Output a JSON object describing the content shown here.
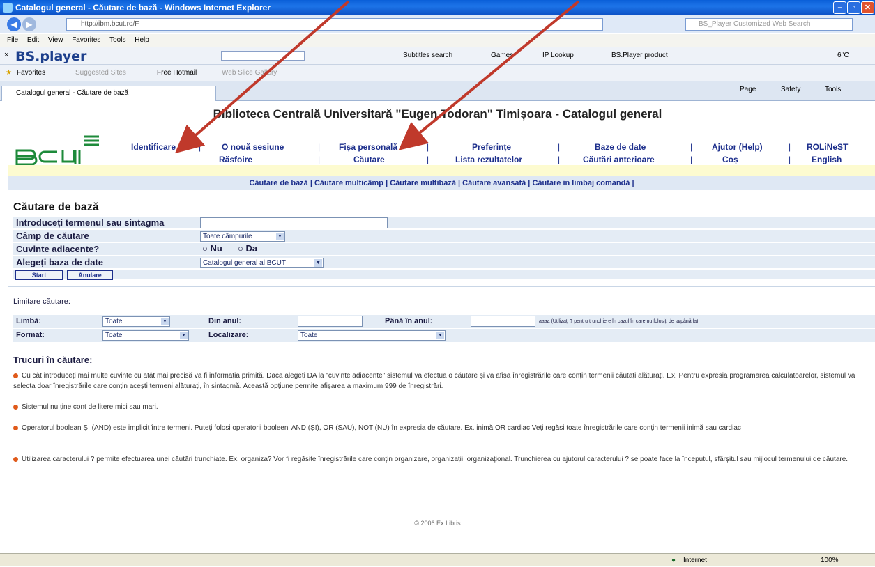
{
  "window": {
    "title": "Catalogul general - Căutare de bază - Windows Internet Explorer",
    "url": "http://ibm.bcut.ro/F",
    "search_placeholder": "BS_Player Customized Web Search",
    "tab_title": "Catalogul general - Căutare de bază"
  },
  "menu": [
    "File",
    "Edit",
    "View",
    "Favorites",
    "Tools",
    "Help"
  ],
  "bsbar": {
    "logo": "BS.player",
    "items": [
      "Subtitles search",
      "Games",
      "IP Lookup",
      "BS.Player product"
    ],
    "temp": "6°C"
  },
  "favbar": [
    "Favorites",
    "Suggested Sites",
    "Free Hotmail",
    "Web Slice Gallery"
  ],
  "ie_tools": [
    "Page",
    "Safety",
    "Tools"
  ],
  "page": {
    "heading": "Biblioteca Centrală Universitară \"Eugen Todoran\" Timișoara - Catalogul general",
    "nav_row1": [
      "Identificare",
      "O nouă sesiune",
      "Fișa personală",
      "Preferințe",
      "Baze de date",
      "Ajutor (Help)",
      "ROLiNeST"
    ],
    "nav_row2": [
      "Răsfoire",
      "Căutare",
      "Lista rezultatelor",
      "Căutări anterioare",
      "Coș",
      "English"
    ],
    "subnav": "Căutare de bază | Căutare multicâmp | Căutare multibază | Căutare avansată | Căutare în limbaj comandă |",
    "section_title": "Căutare de bază",
    "form": {
      "term_label": "Introduceți termenul sau sintagma",
      "field_label": "Câmp de căutare",
      "field_value": "Toate câmpurile",
      "adjacent_label": "Cuvinte adiacente?",
      "adjacent_no": "Nu",
      "adjacent_yes": "Da",
      "db_label": "Alegeți baza de date",
      "db_value": "Catalogul general al BCUT",
      "start": "Start",
      "cancel": "Anulare"
    },
    "limits": {
      "title": "Limitare căutare:",
      "lang_label": "Limbă:",
      "lang_value": "Toate",
      "from_label": "Din anul:",
      "to_label": "Până în anul:",
      "year_hint": "aaaa (Utilizați ? pentru trunchiere în cazul în care nu folosiți de la/până la)",
      "format_label": "Format:",
      "format_value": "Toate",
      "loc_label": "Localizare:",
      "loc_value": "Toate"
    },
    "tricks_title": "Trucuri în căutare:",
    "tips": [
      "Cu cât introduceți mai multe cuvinte cu atât mai precisă va fi informația primită. Daca alegeți DA la \"cuvinte adiacente\" sistemul va efectua o căutare și va afișa înregistrările care conțin termenii căutați alăturați. Ex. Pentru expresia programarea calculatoarelor, sistemul va selecta doar înregistrările care conțin acești termeni alăturați, în sintagmă. Această opțiune permite afișarea a maximum 999 de înregistrări.",
      "Sistemul nu ține cont de litere mici sau mari.",
      "Operatorul boolean ȘI (AND) este implicit între termeni. Puteți folosi operatorii booleeni AND (ȘI), OR (SAU), NOT (NU) în expresia de căutare. Ex. inimă OR cardiac Veți regăsi toate înregistrările care conțin termenii inimă sau cardiac",
      "Utilizarea caracterului ? permite efectuarea unei căutări trunchiate. Ex. organiza? Vor fi regăsite înregistrările care conțin organizare, organizații, organizațional. Trunchierea cu ajutorul caracterului ? se poate face la începutul, sfârșitul sau mijlocul termenului de căutare."
    ],
    "copyright": "© 2006 Ex Libris"
  },
  "status": {
    "zone": "Internet",
    "zoom": "100%"
  },
  "colors": {
    "nav_blue": "#1d2f8c",
    "row_bg": "#e4ecf5",
    "arrow": "#c0392b"
  }
}
